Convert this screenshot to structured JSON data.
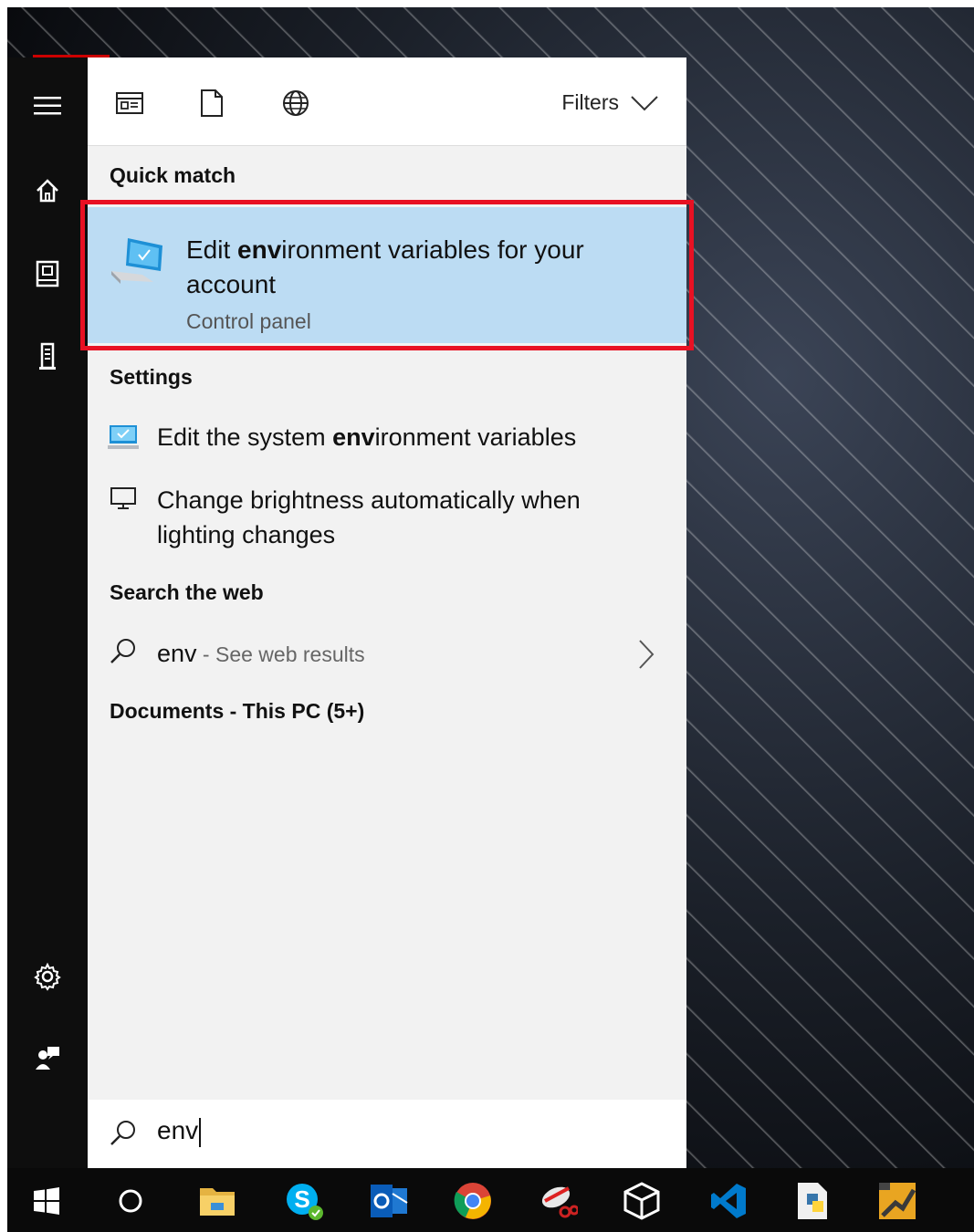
{
  "filters_label": "Filters",
  "sections": {
    "quick_match": "Quick match",
    "settings": "Settings",
    "search_web": "Search the web",
    "documents": "Documents - This PC (5+)"
  },
  "quick_match": {
    "title_pre": "Edit ",
    "title_bold": "env",
    "title_post": "ironment variables for your account",
    "subtitle": "Control panel"
  },
  "settings_items": [
    {
      "pre": "Edit the system ",
      "bold": "env",
      "post": "ironment variables",
      "icon": "system-properties-icon"
    },
    {
      "pre": "Change brightness automatically when lighting changes",
      "bold": "",
      "post": "",
      "icon": "monitor-icon"
    }
  ],
  "web": {
    "query": "env",
    "hint": " - See web results"
  },
  "search": {
    "value": "env"
  },
  "rail_icons": [
    "menu-icon",
    "home-icon",
    "notebook-icon",
    "devices-icon",
    "settings-icon",
    "feedback-icon"
  ],
  "taskbar_icons": [
    "windows-start-icon",
    "cortana-icon",
    "file-explorer-icon",
    "skype-icon",
    "outlook-icon",
    "chrome-icon",
    "snipping-tool-icon",
    "virtualbox-icon",
    "vscode-icon",
    "python-icon",
    "app-icon"
  ],
  "colors": {
    "highlight_bg": "#bcdcf3",
    "highlight_border": "#e81123",
    "rail_bg": "#0e0e0e",
    "accent_red": "#cc0000"
  }
}
